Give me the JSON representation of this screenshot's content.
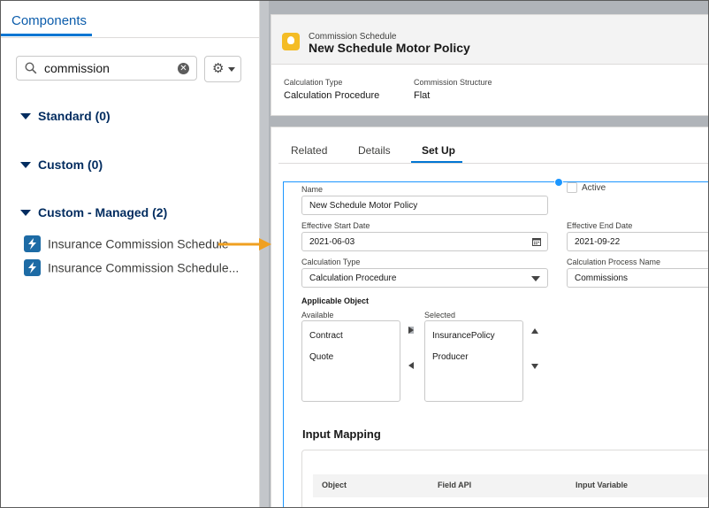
{
  "left_panel": {
    "tab_label": "Components",
    "search": {
      "value": "commission",
      "placeholder": ""
    },
    "sections": [
      {
        "label": "Standard (0)"
      },
      {
        "label": "Custom (0)"
      },
      {
        "label": "Custom - Managed (2)"
      }
    ],
    "components": [
      {
        "label": "Insurance Commission Schedule"
      },
      {
        "label": "Insurance Commission Schedule..."
      }
    ]
  },
  "record": {
    "object_name": "Commission Schedule",
    "title": "New Schedule Motor Policy",
    "highlights": [
      {
        "label": "Calculation Type",
        "value": "Calculation Procedure"
      },
      {
        "label": "Commission Structure",
        "value": "Flat"
      }
    ]
  },
  "tabs": [
    {
      "label": "Related"
    },
    {
      "label": "Details"
    },
    {
      "label": "Set Up",
      "active": true
    }
  ],
  "form": {
    "name_label": "Name",
    "name_value": "New Schedule Motor Policy",
    "active_label": "Active",
    "active_checked": false,
    "start_label": "Effective Start Date",
    "start_value": "2021-06-03",
    "end_label": "Effective End Date",
    "end_value": "2021-09-22",
    "calc_type_label": "Calculation Type",
    "calc_type_value": "Calculation Procedure",
    "process_label": "Calculation Process Name",
    "process_value": "Commissions",
    "applicable_label": "Applicable Object",
    "available_label": "Available",
    "available_options": [
      "Contract",
      "Quote"
    ],
    "selected_label": "Selected",
    "selected_options": [
      "InsurancePolicy",
      "Producer"
    ],
    "input_mapping_title": "Input Mapping",
    "mapping_columns": [
      "Object",
      "Field API",
      "Input Variable"
    ]
  },
  "colors": {
    "accent": "#0176d3",
    "arrow": "#f0a020",
    "component_icon": "#1d6ba5",
    "record_icon": "#f4bc25"
  }
}
